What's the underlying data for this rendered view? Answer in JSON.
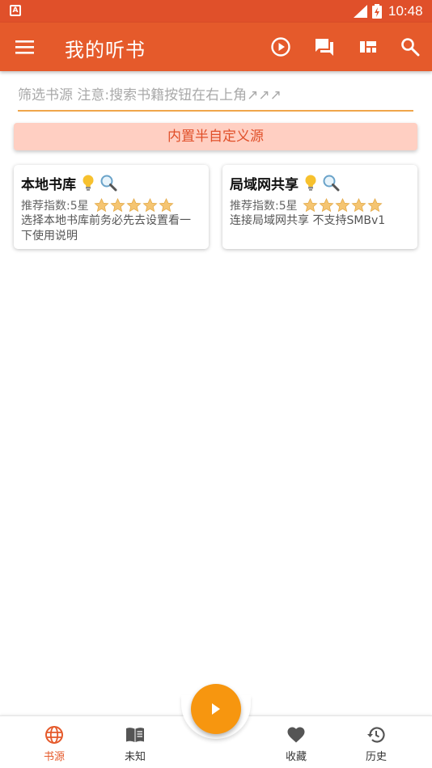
{
  "status_bar": {
    "time": "10:48",
    "app_indicator": "A"
  },
  "app_bar": {
    "title": "我的听书",
    "background": "#e55a2b",
    "actions": [
      "play-circle-icon",
      "chat-icon",
      "view-quilt-icon",
      "search-icon"
    ]
  },
  "search": {
    "placeholder": "筛选书源 注意:搜索书籍按钮在右上角↗↗↗",
    "value": ""
  },
  "builtin_button": {
    "label": "内置半自定义源"
  },
  "sources": [
    {
      "name": "本地书库",
      "recommend": "推荐指数:5星",
      "stars": 5,
      "description": "选择本地书库前务必先去设置看一下使用说明"
    },
    {
      "name": "局域网共享",
      "recommend": "推荐指数:5星",
      "stars": 5,
      "description": "连接局域网共享 不支持SMBv1"
    }
  ],
  "bottom_nav": {
    "items": [
      {
        "label": "书源",
        "icon": "globe-icon",
        "active": true
      },
      {
        "label": "未知",
        "icon": "book-icon",
        "active": false
      },
      {
        "label": "收藏",
        "icon": "heart-icon",
        "active": false
      },
      {
        "label": "历史",
        "icon": "history-icon",
        "active": false
      }
    ],
    "fab_icon": "play-icon"
  },
  "colors": {
    "accent": "#e55a2b",
    "fab": "#f7960f",
    "underline": "#f0a64a",
    "builtin_bg": "#ffcfc2",
    "star": "#f5c572"
  }
}
